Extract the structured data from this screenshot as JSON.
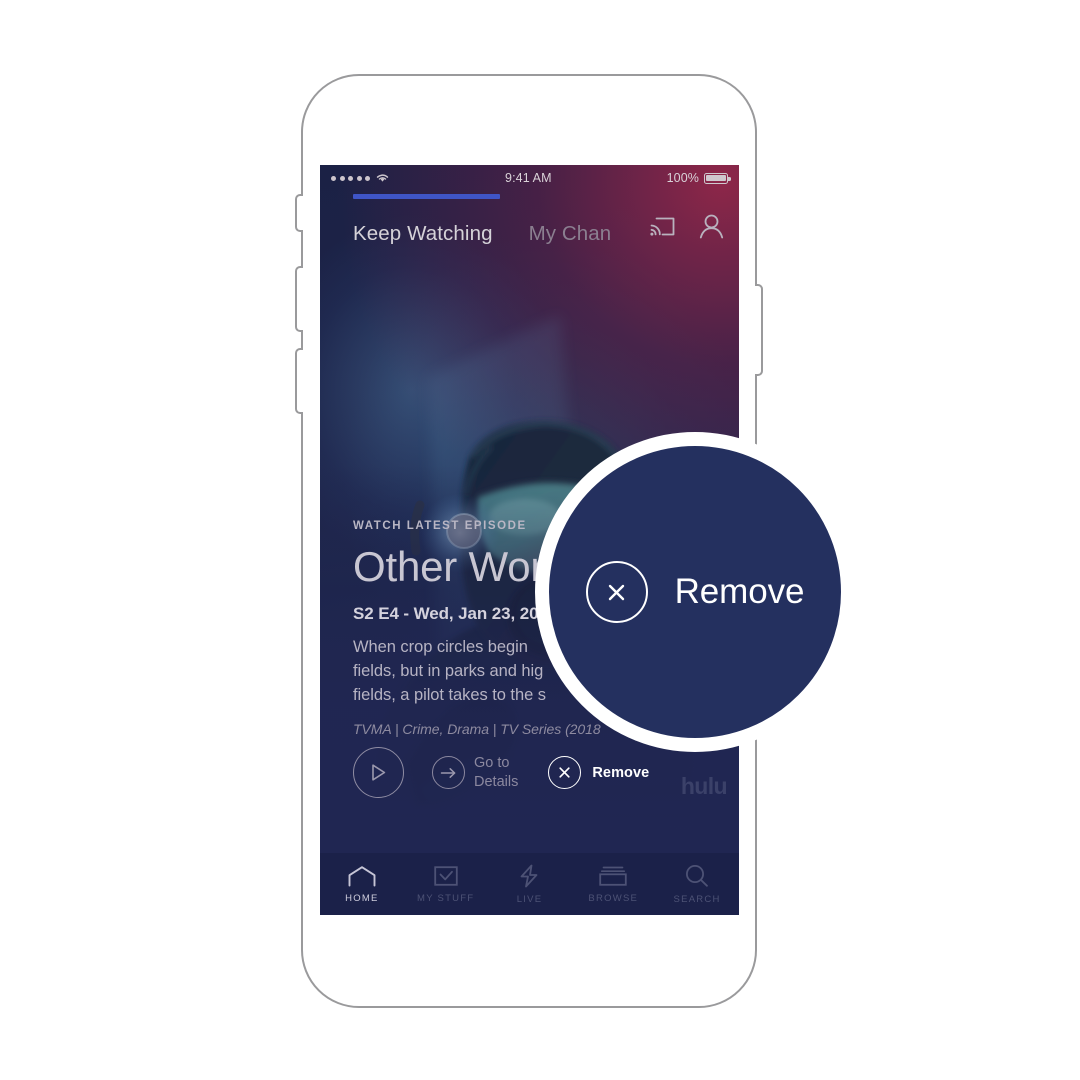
{
  "device": {
    "name": "smartphone-mockup",
    "buttons": [
      "silent-switch",
      "volume-up",
      "volume-down",
      "power"
    ]
  },
  "status_bar": {
    "signal_dots": 5,
    "wifi_icon": "wifi-icon",
    "time": "9:41 AM",
    "battery_percent": "100%",
    "battery_icon": "battery-full-icon"
  },
  "tabs": {
    "items": [
      {
        "label": "Keep Watching",
        "active": true
      },
      {
        "label": "My Chan",
        "active": false
      }
    ],
    "cast_icon": "cast-icon",
    "profile_icon": "profile-icon",
    "underline_color": "#3f55c6"
  },
  "hero": {
    "eyebrow": "WATCH LATEST EPISODE",
    "title": "Other Wor",
    "subtitle": "S2 E4 - Wed, Jan 23, 20",
    "description": "When crop circles begin\nfields, but in parks and hig\nfields, a pilot takes to the s",
    "meta": "TVMA | Crime, Drama | TV Series (2018",
    "artwork_alt": "gas-mask-figure-artwork"
  },
  "actions": {
    "play": {
      "icon": "play-icon",
      "label": ""
    },
    "details": {
      "icon": "arrow-right-icon",
      "label": "Go to\nDetails"
    },
    "remove": {
      "icon": "close-circle-icon",
      "label": "Remove"
    },
    "brand": "hulu"
  },
  "bottom_nav": {
    "items": [
      {
        "label": "HOME",
        "icon": "home-icon",
        "active": true
      },
      {
        "label": "MY STUFF",
        "icon": "check-box-icon",
        "active": false
      },
      {
        "label": "LIVE",
        "icon": "lightning-bolt-icon",
        "active": false
      },
      {
        "label": "BROWSE",
        "icon": "stacked-cards-icon",
        "active": false
      },
      {
        "label": "SEARCH",
        "icon": "search-icon",
        "active": false
      }
    ]
  },
  "callout": {
    "icon": "close-circle-icon",
    "label": "Remove",
    "fill_color": "#24305f",
    "ring_color": "#ffffff"
  }
}
